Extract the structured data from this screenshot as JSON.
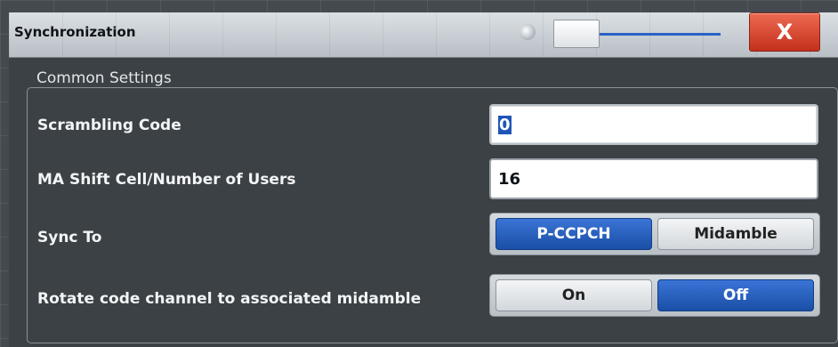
{
  "window": {
    "title": "Synchronization",
    "close_label": "X"
  },
  "common_settings": {
    "title": "Common Settings",
    "scrambling_code": {
      "label": "Scrambling Code",
      "value": "0"
    },
    "ma_shift": {
      "label": "MA Shift Cell/Number of Users",
      "value": "16"
    },
    "sync_to": {
      "label": "Sync To",
      "options": [
        "P-CCPCH",
        "Midamble"
      ],
      "selected": "P-CCPCH"
    },
    "rotate": {
      "label": "Rotate code channel to associated midamble",
      "options": [
        "On",
        "Off"
      ],
      "selected": "Off"
    }
  },
  "colors": {
    "selected_button": "#1a4fa6",
    "close_button": "#c3301b",
    "dialog_background": "#3c4145"
  }
}
